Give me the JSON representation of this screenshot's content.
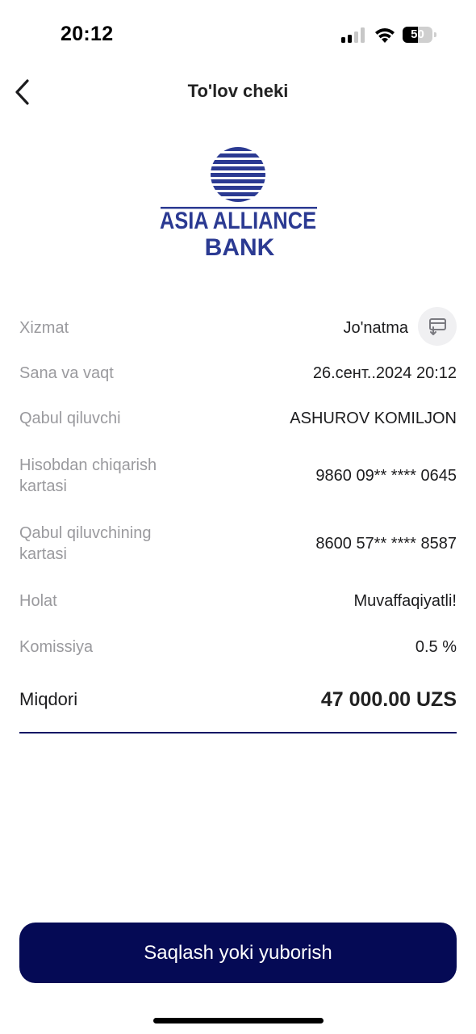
{
  "status_bar": {
    "time": "20:12",
    "battery_level": "50",
    "battery_fraction": 0.5,
    "signal_bars_active": 2,
    "signal_bars_total": 4
  },
  "header": {
    "title": "To'lov cheki",
    "back_icon": "chevron-left-icon"
  },
  "logo": {
    "line1": "ASIA ALLIANCE",
    "line2": "BANK",
    "color": "#2b3a92"
  },
  "details": [
    {
      "label": "Xizmat",
      "value": "Jo'natma",
      "icon": "transfer-icon"
    },
    {
      "label": "Sana va vaqt",
      "value": "26.сент..2024 20:12"
    },
    {
      "label": "Qabul qiluvchi",
      "value": "ASHUROV KOMILJON"
    },
    {
      "label": "Hisobdan chiqarish kartasi",
      "value": "9860 09** **** 0645"
    },
    {
      "label": "Qabul qiluvchining kartasi",
      "value": "8600 57** **** 8587"
    },
    {
      "label": "Holat",
      "value": "Muvaffaqiyatli!"
    },
    {
      "label": "Komissiya",
      "value": "0.5 %"
    }
  ],
  "amount": {
    "label": "Miqdori",
    "value": "47 000.00 UZS"
  },
  "actions": {
    "save_or_send_label": "Saqlash yoki yuborish"
  },
  "colors": {
    "primary": "#050a55",
    "label_gray": "#9a9a9e",
    "divider": "#0a1464"
  }
}
